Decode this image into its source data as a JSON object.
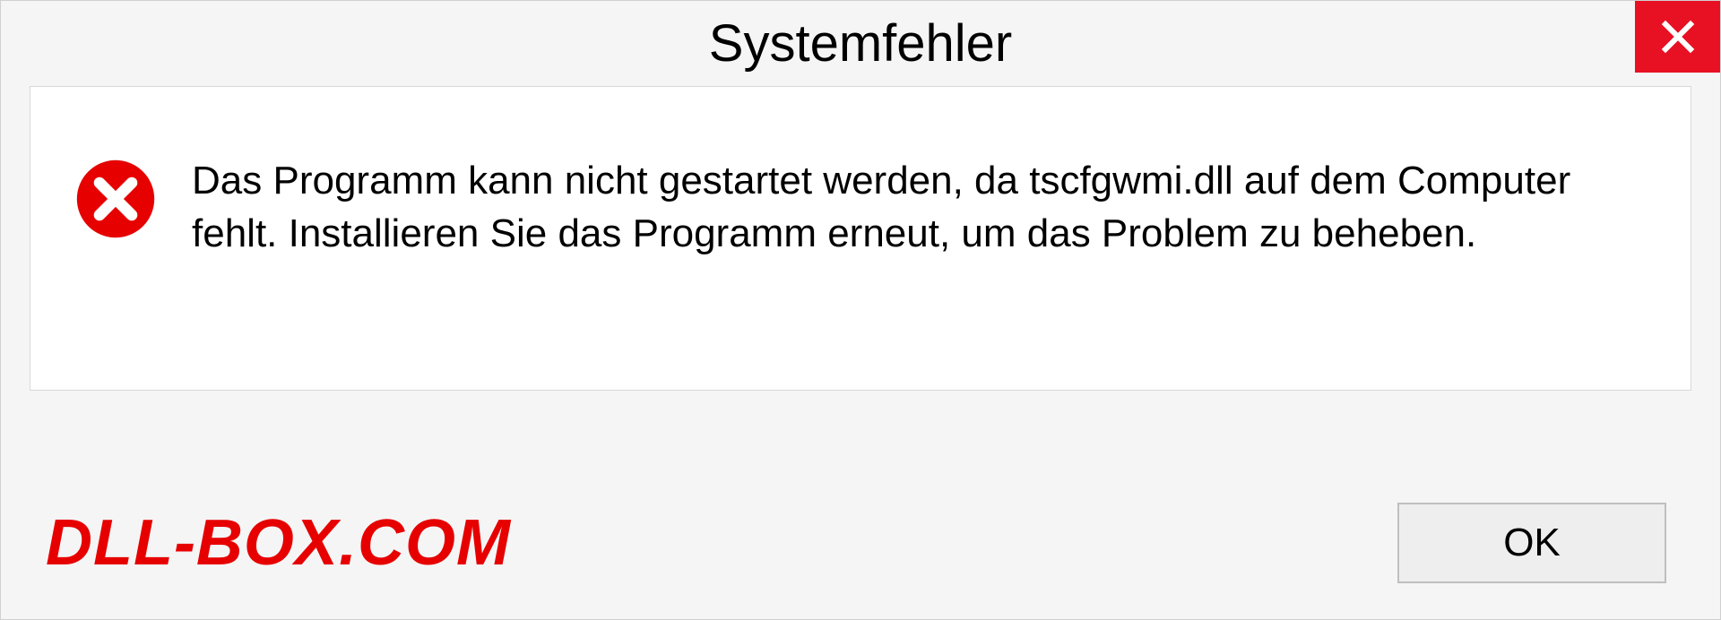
{
  "dialog": {
    "title": "Systemfehler",
    "message": "Das Programm kann nicht gestartet werden, da tscfgwmi.dll auf dem Computer fehlt. Installieren Sie das Programm erneut, um das Problem zu beheben.",
    "ok_label": "OK"
  },
  "watermark": {
    "text": "DLL-BOX.COM"
  },
  "colors": {
    "close_red": "#e81123",
    "error_red": "#e60000",
    "watermark_red": "#e60000"
  }
}
